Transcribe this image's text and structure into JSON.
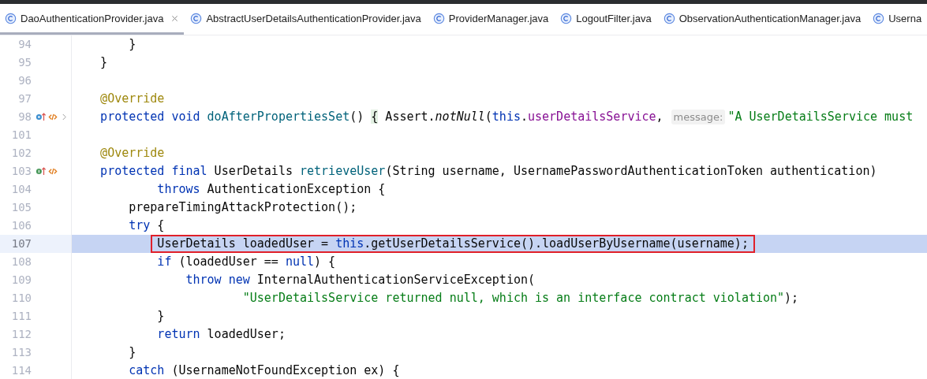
{
  "tabs": [
    {
      "label": "DaoAuthenticationProvider.java",
      "selected": true
    },
    {
      "label": "AbstractUserDetailsAuthenticationProvider.java",
      "selected": false
    },
    {
      "label": "ProviderManager.java",
      "selected": false
    },
    {
      "label": "LogoutFilter.java",
      "selected": false
    },
    {
      "label": "ObservationAuthenticationManager.java",
      "selected": false
    },
    {
      "label": "Userna",
      "selected": false
    }
  ],
  "lines": [
    {
      "number": "94",
      "current": false,
      "boxed": false,
      "tokens": [
        {
          "kind": "plain",
          "text": "        }"
        }
      ]
    },
    {
      "number": "95",
      "current": false,
      "boxed": false,
      "tokens": [
        {
          "kind": "plain",
          "text": "    }"
        }
      ]
    },
    {
      "number": "96",
      "current": false,
      "boxed": false
    },
    {
      "number": "97",
      "current": false,
      "boxed": false,
      "tokens": [
        {
          "kind": "ann",
          "text": "    @Override"
        }
      ]
    },
    {
      "number": "98",
      "current": false,
      "boxed": false,
      "markers": [
        {
          "kind": "overriding"
        },
        {
          "kind": "related"
        },
        {
          "kind": "fold"
        }
      ],
      "tokens": [
        {
          "kind": "kw",
          "text": "    protected void "
        },
        {
          "kind": "fn",
          "text": "doAfterPropertiesSet"
        },
        {
          "kind": "plain",
          "text": "() "
        },
        {
          "kind": "fold",
          "text": "{"
        },
        {
          "kind": "plain",
          "text": " Assert."
        },
        {
          "kind": "static",
          "text": "notNull"
        },
        {
          "kind": "plain",
          "text": "("
        },
        {
          "kind": "kw",
          "text": "this"
        },
        {
          "kind": "plain",
          "text": "."
        },
        {
          "kind": "field",
          "text": "userDetailsService"
        },
        {
          "kind": "plain",
          "text": ","
        },
        {
          "kind": "hint",
          "text": "message:"
        },
        {
          "kind": "str",
          "text": "\"A UserDetailsService must"
        }
      ]
    },
    {
      "number": "101",
      "current": false,
      "boxed": false
    },
    {
      "number": "102",
      "current": false,
      "boxed": false,
      "tokens": [
        {
          "kind": "ann",
          "text": "    @Override"
        }
      ]
    },
    {
      "number": "103",
      "current": false,
      "boxed": false,
      "markers": [
        {
          "kind": "implementing"
        },
        {
          "kind": "related"
        }
      ],
      "tokens": [
        {
          "kind": "kw",
          "text": "    protected final"
        },
        {
          "kind": "plain",
          "text": " UserDetails "
        },
        {
          "kind": "fn",
          "text": "retrieveUser"
        },
        {
          "kind": "plain",
          "text": "(String username, UsernamePasswordAuthenticationToken authentication)"
        }
      ]
    },
    {
      "number": "104",
      "current": false,
      "boxed": false,
      "tokens": [
        {
          "kind": "kw",
          "text": "            throws"
        },
        {
          "kind": "plain",
          "text": " AuthenticationException {"
        }
      ]
    },
    {
      "number": "105",
      "current": false,
      "boxed": false,
      "tokens": [
        {
          "kind": "plain",
          "text": "        prepareTimingAttackProtection();"
        }
      ]
    },
    {
      "number": "106",
      "current": false,
      "boxed": false,
      "tokens": [
        {
          "kind": "kw",
          "text": "        try"
        },
        {
          "kind": "plain",
          "text": " {"
        }
      ]
    },
    {
      "number": "107",
      "current": true,
      "boxed": true,
      "tokens": [
        {
          "kind": "plain",
          "text": "            UserDetails loadedUser = "
        },
        {
          "kind": "kw",
          "text": "this"
        },
        {
          "kind": "plain",
          "text": ".getUserDetailsService().loadUserByUsername(username);"
        }
      ]
    },
    {
      "number": "108",
      "current": false,
      "boxed": false,
      "tokens": [
        {
          "kind": "kw",
          "text": "            if"
        },
        {
          "kind": "plain",
          "text": " (loadedUser == "
        },
        {
          "kind": "kw",
          "text": "null"
        },
        {
          "kind": "plain",
          "text": ") {"
        }
      ]
    },
    {
      "number": "109",
      "current": false,
      "boxed": false,
      "tokens": [
        {
          "kind": "kw",
          "text": "                throw new"
        },
        {
          "kind": "plain",
          "text": " InternalAuthenticationServiceException("
        }
      ]
    },
    {
      "number": "110",
      "current": false,
      "boxed": false,
      "tokens": [
        {
          "kind": "str",
          "text": "                        \"UserDetailsService returned null, which is an interface contract violation\""
        },
        {
          "kind": "plain",
          "text": ");"
        }
      ]
    },
    {
      "number": "111",
      "current": false,
      "boxed": false,
      "tokens": [
        {
          "kind": "plain",
          "text": "            }"
        }
      ]
    },
    {
      "number": "112",
      "current": false,
      "boxed": false,
      "tokens": [
        {
          "kind": "kw",
          "text": "            return"
        },
        {
          "kind": "plain",
          "text": " loadedUser;"
        }
      ]
    },
    {
      "number": "113",
      "current": false,
      "boxed": false,
      "tokens": [
        {
          "kind": "plain",
          "text": "        }"
        }
      ]
    },
    {
      "number": "114",
      "current": false,
      "boxed": false,
      "tokens": [
        {
          "kind": "kw",
          "text": "        catch"
        },
        {
          "kind": "plain",
          "text": " (UsernameNotFoundException ex) {"
        }
      ]
    }
  ]
}
